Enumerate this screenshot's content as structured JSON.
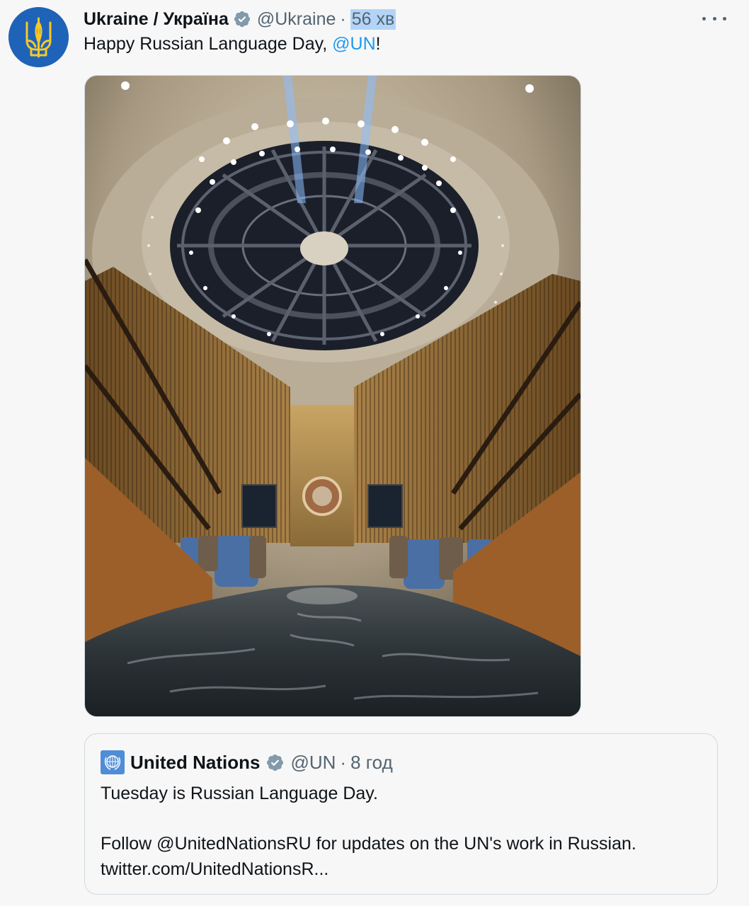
{
  "tweet": {
    "display_name": "Ukraine / Україна",
    "handle": "@Ukraine",
    "separator": "·",
    "time": "56 хв",
    "text_before": "Happy Russian Language Day, ",
    "mention": "@UN",
    "text_after": "!",
    "avatar_icon": "trident-icon",
    "media_description_icon": "general-assembly-hall-image"
  },
  "quoted_tweet": {
    "display_name": "United Nations",
    "handle": "@UN",
    "separator": "·",
    "time": "8 год",
    "line1": "Tuesday is Russian Language Day.",
    "line2": "Follow @UnitedNationsRU for updates on the UN's work in Russian.",
    "line3": "twitter.com/UnitedNationsR..."
  },
  "colors": {
    "accent": "#1d9bf0",
    "verified": "#829aab",
    "avatar_bg": "#1f63b8",
    "trident": "#f6c829",
    "selection": "#b3d4f7"
  }
}
